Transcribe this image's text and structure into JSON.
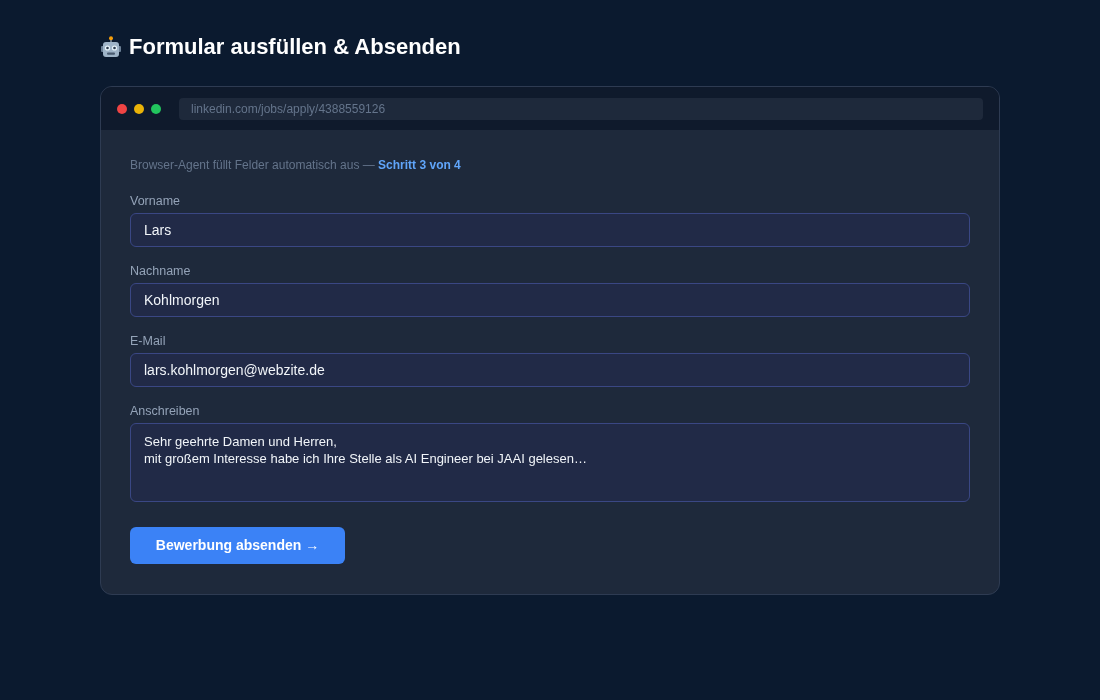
{
  "page": {
    "title": "Formular ausfüllen & Absenden"
  },
  "browser": {
    "url": "linkedin.com/jobs/apply/4388559126"
  },
  "form": {
    "status": "Browser-Agent füllt Felder automatisch aus — **Schritt 3 von 4**",
    "fields": [
      {
        "kind": "input",
        "label": "Vorname",
        "value": "Lars"
      },
      {
        "kind": "input",
        "label": "Nachname",
        "value": "Kohlmorgen"
      },
      {
        "kind": "input",
        "label": "E-Mail",
        "value": "lars.kohlmorgen@webzite.de"
      },
      {
        "kind": "textarea",
        "label": "Anschreiben",
        "lines": [
          "Sehr geehrte Damen und Herren,",
          "mit großem Interesse habe ich Ihre Stelle als AI Engineer bei JAAI gelesen…"
        ]
      }
    ],
    "submit_button": "Bewerbung absenden →"
  }
}
